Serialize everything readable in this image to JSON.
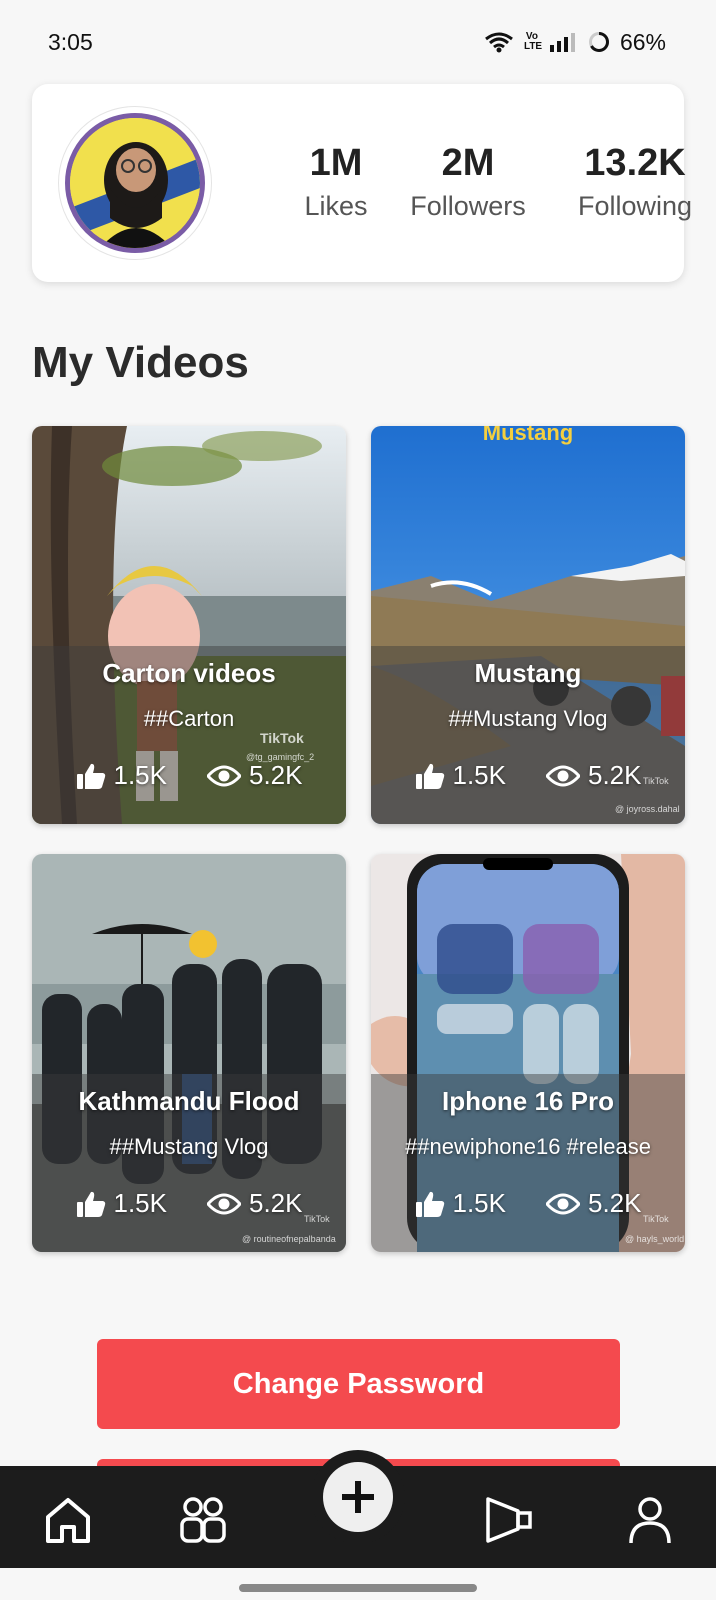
{
  "status_bar": {
    "time": "3:05",
    "battery": "66%",
    "volte_top": "Vo",
    "volte_bottom": "LTE"
  },
  "profile": {
    "stats": [
      {
        "value": "1M",
        "label": "Likes"
      },
      {
        "value": "2M",
        "label": "Followers"
      },
      {
        "value": "13.2K",
        "label": "Following"
      }
    ]
  },
  "section_title": "My Videos",
  "videos": [
    {
      "title": "Carton videos",
      "tag": "##Carton",
      "likes": "1.5K",
      "views": "5.2K",
      "watermark_user": "@tg_gamingfc_2"
    },
    {
      "title": "Mustang",
      "tag": "##Mustang Vlog",
      "likes": "1.5K",
      "views": "5.2K",
      "watermark_user": "@ joyross.dahal",
      "thumb_caption": "Mustang"
    },
    {
      "title": "Kathmandu Flood",
      "tag": "##Mustang Vlog",
      "likes": "1.5K",
      "views": "5.2K",
      "watermark_user": "@ routineofnepalbanda"
    },
    {
      "title": "Iphone 16 Pro",
      "tag": "##newiphone16 #release",
      "likes": "1.5K",
      "views": "5.2K",
      "watermark_user": "@ hayls_world"
    }
  ],
  "tiktok_watermark": "TikTok",
  "change_password_label": "Change Password",
  "colors": {
    "accent": "#f44a4e",
    "nav_bg": "#1c1c1c",
    "background": "#f7f7f7"
  },
  "nav": {
    "items": [
      "home-icon",
      "friends-icon",
      "add-icon",
      "promote-icon",
      "profile-icon"
    ]
  }
}
